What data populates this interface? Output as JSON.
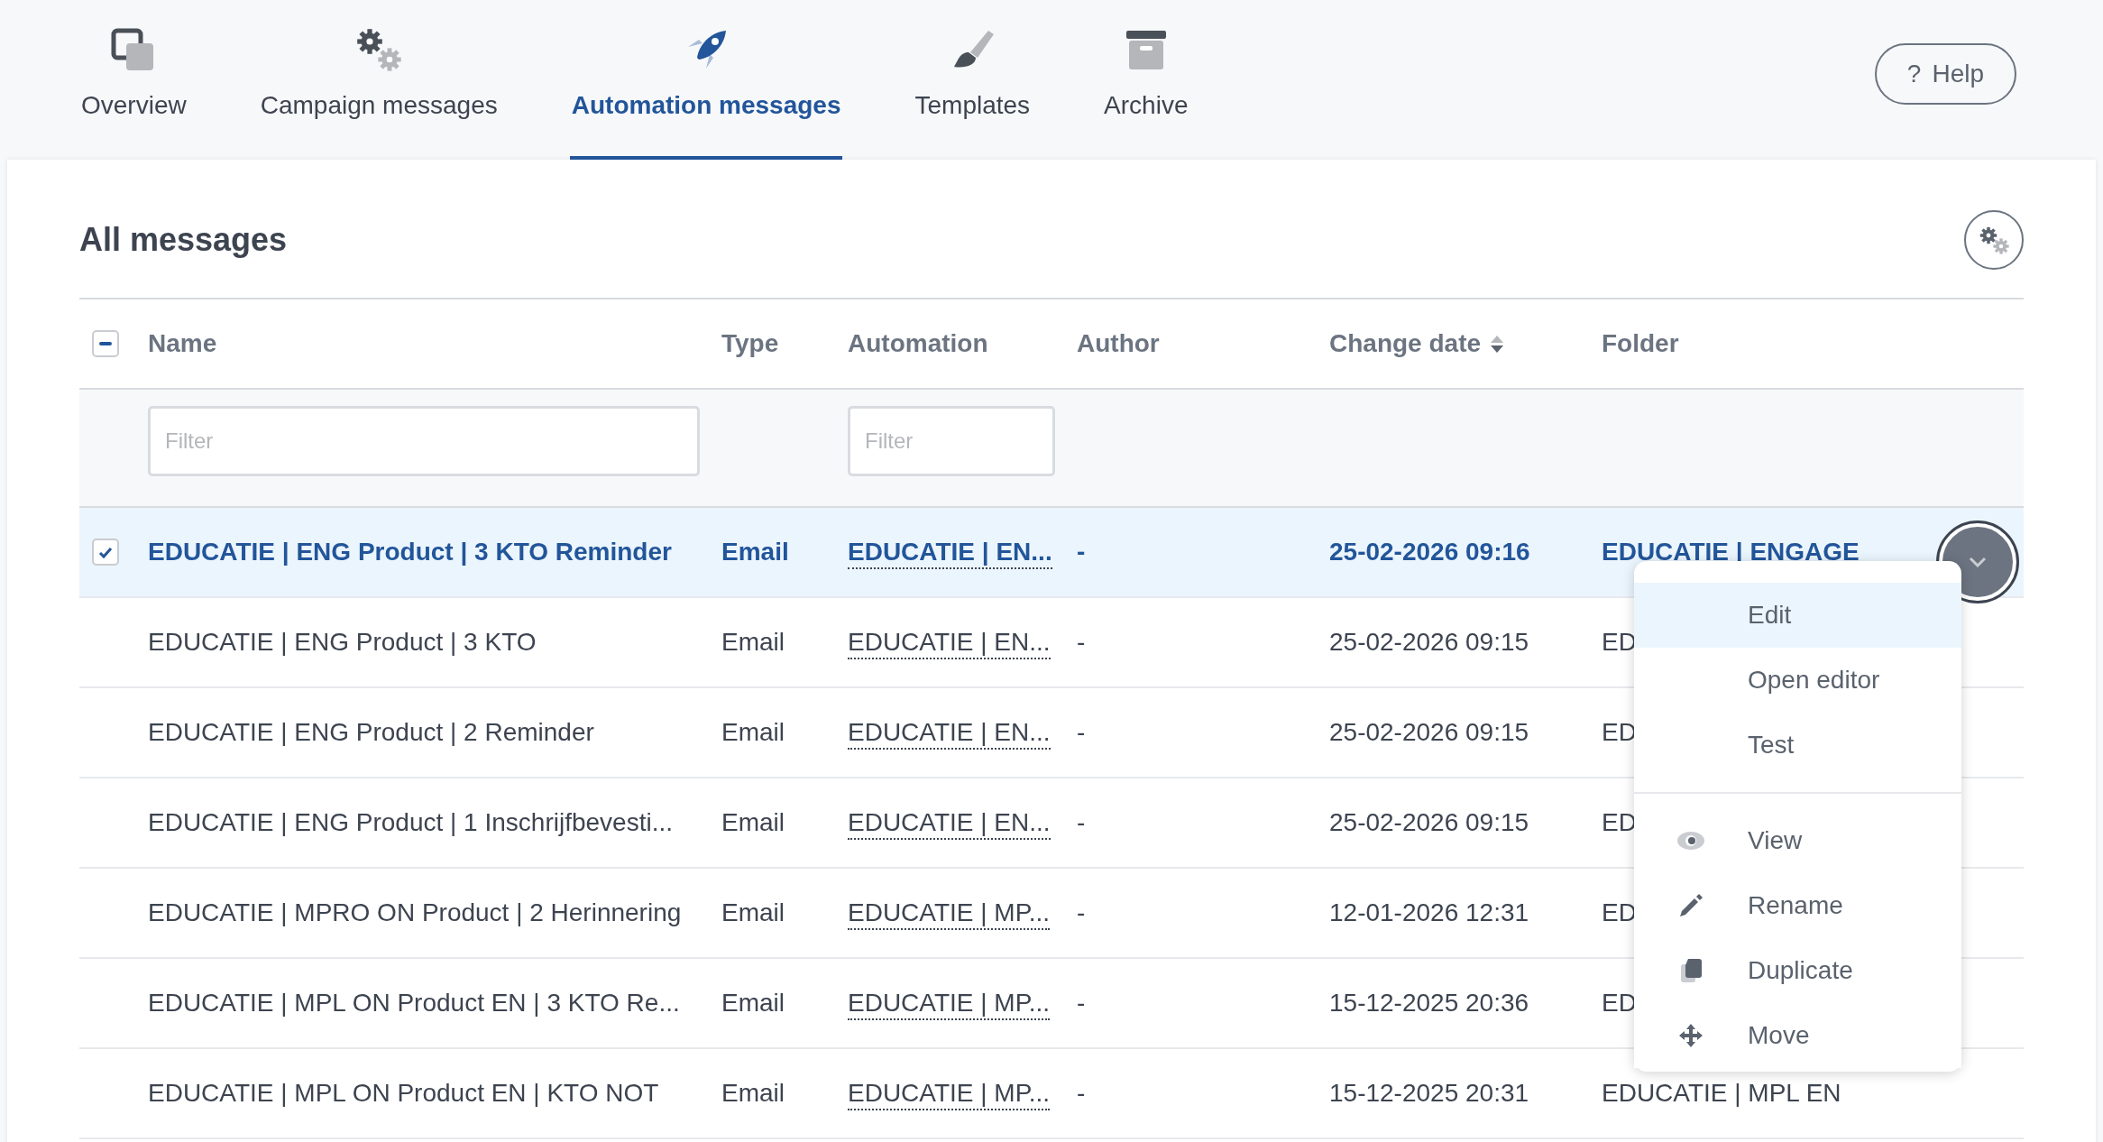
{
  "nav": {
    "tabs": [
      {
        "label": "Overview",
        "selected": false
      },
      {
        "label": "Campaign messages",
        "selected": false
      },
      {
        "label": "Automation messages",
        "selected": true
      },
      {
        "label": "Templates",
        "selected": false
      },
      {
        "label": "Archive",
        "selected": false
      }
    ],
    "help": {
      "icon": "?",
      "label": "Help"
    }
  },
  "panel": {
    "title": "All messages"
  },
  "table": {
    "select_all_indeterminate": true,
    "columns": [
      {
        "label": "Name",
        "filter": {
          "placeholder": "Filter"
        }
      },
      {
        "label": "Type"
      },
      {
        "label": "Automation",
        "filter": {
          "placeholder": "Filter"
        }
      },
      {
        "label": "Author"
      },
      {
        "label": "Change date",
        "sortable": true
      },
      {
        "label": "Folder"
      }
    ],
    "rows": [
      {
        "selected": true,
        "name": "EDUCATIE | ENG Product | 3 KTO Reminder",
        "type": "Email",
        "automation": "EDUCATIE | EN...",
        "author": "-",
        "change_date": "25-02-2026 09:16",
        "folder": "EDUCATIE | ENGAGE"
      },
      {
        "selected": false,
        "name": "EDUCATIE | ENG Product | 3 KTO",
        "type": "Email",
        "automation": "EDUCATIE | EN...",
        "author": "-",
        "change_date": "25-02-2026 09:15",
        "folder": "ED"
      },
      {
        "selected": false,
        "name": "EDUCATIE | ENG Product | 2 Reminder",
        "type": "Email",
        "automation": "EDUCATIE | EN...",
        "author": "-",
        "change_date": "25-02-2026 09:15",
        "folder": "ED"
      },
      {
        "selected": false,
        "name": "EDUCATIE | ENG Product | 1 Inschrijfbevesti...",
        "type": "Email",
        "automation": "EDUCATIE | EN...",
        "author": "-",
        "change_date": "25-02-2026 09:15",
        "folder": "ED"
      },
      {
        "selected": false,
        "name": "EDUCATIE | MPRO ON Product | 2 Herinnering",
        "type": "Email",
        "automation": "EDUCATIE | MP...",
        "author": "-",
        "change_date": "12-01-2026 12:31",
        "folder": "ED"
      },
      {
        "selected": false,
        "name": "EDUCATIE | MPL ON Product EN | 3 KTO Re...",
        "type": "Email",
        "automation": "EDUCATIE | MP...",
        "author": "-",
        "change_date": "15-12-2025 20:36",
        "folder": "ED"
      },
      {
        "selected": false,
        "name": "EDUCATIE | MPL ON Product EN | KTO NOT",
        "type": "Email",
        "automation": "EDUCATIE | MP...",
        "author": "-",
        "change_date": "15-12-2025 20:31",
        "folder": "EDUCATIE | MPL EN"
      }
    ]
  },
  "row_menu": {
    "groups": [
      [
        {
          "label": "Edit",
          "selected": true
        },
        {
          "label": "Open editor",
          "selected": false
        },
        {
          "label": "Test",
          "selected": false
        }
      ],
      [
        {
          "label": "View",
          "selected": false
        },
        {
          "label": "Rename",
          "selected": false
        },
        {
          "label": "Duplicate",
          "selected": false
        },
        {
          "label": "Move",
          "selected": false
        }
      ]
    ]
  }
}
